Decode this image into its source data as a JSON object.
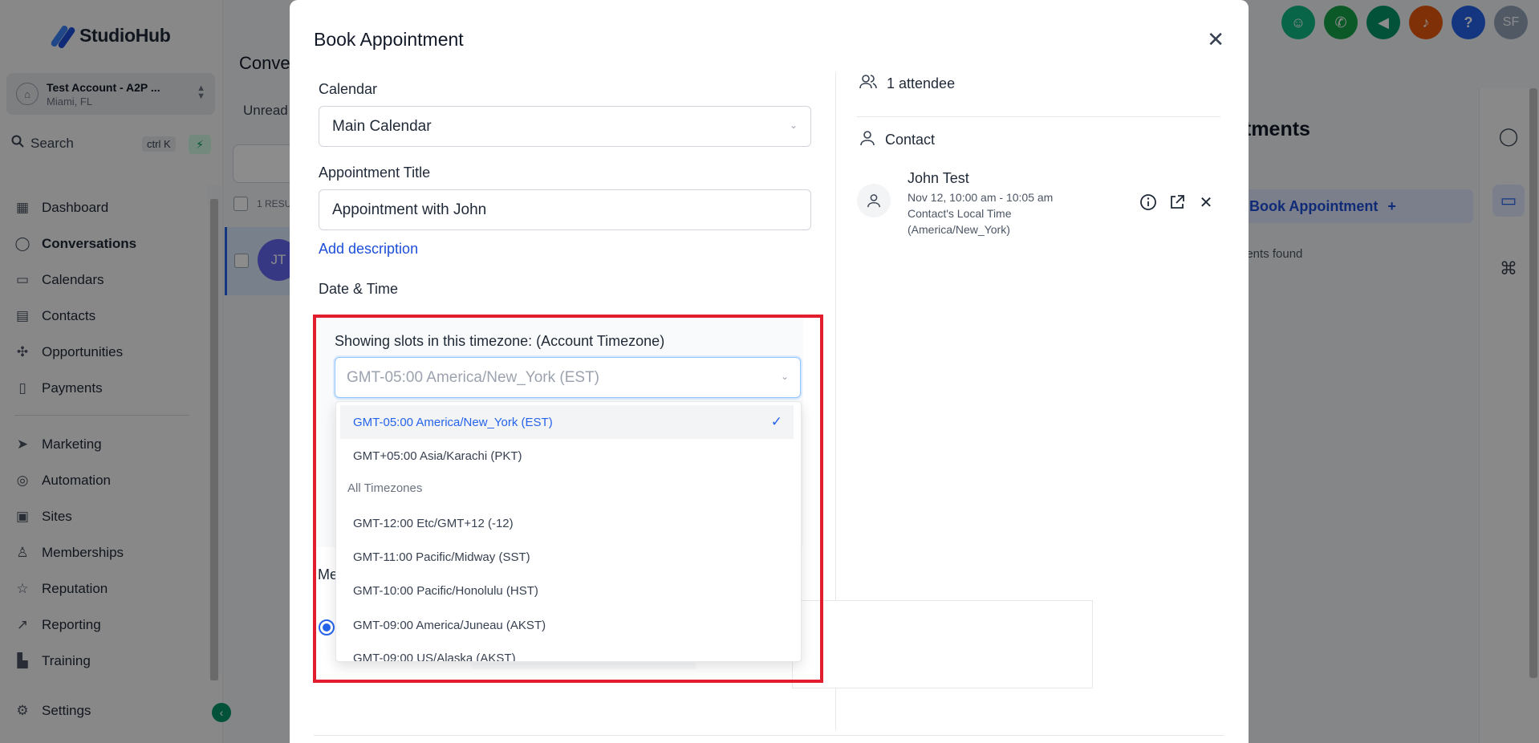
{
  "brand": {
    "name": "StudioHub"
  },
  "account": {
    "name": "Test Account - A2P ...",
    "location": "Miami, FL"
  },
  "search": {
    "label": "Search",
    "shortcut": "ctrl K"
  },
  "sidebar": {
    "items": [
      {
        "label": "Dashboard",
        "icon": "grid-icon"
      },
      {
        "label": "Conversations",
        "icon": "chat-icon"
      },
      {
        "label": "Calendars",
        "icon": "calendar-icon"
      },
      {
        "label": "Contacts",
        "icon": "contacts-icon"
      },
      {
        "label": "Opportunities",
        "icon": "opportunities-icon"
      },
      {
        "label": "Payments",
        "icon": "payments-icon"
      },
      {
        "label": "Marketing",
        "icon": "send-icon"
      },
      {
        "label": "Automation",
        "icon": "automation-icon"
      },
      {
        "label": "Sites",
        "icon": "sites-icon"
      },
      {
        "label": "Memberships",
        "icon": "memberships-icon"
      },
      {
        "label": "Reputation",
        "icon": "star-icon"
      },
      {
        "label": "Reporting",
        "icon": "chart-icon"
      },
      {
        "label": "Training",
        "icon": "book-icon"
      }
    ],
    "settings": "Settings"
  },
  "background": {
    "page_title": "Conve",
    "tab_unread": "Unread",
    "results": "1 RESU",
    "avatar_initials": "JT",
    "appointments_title": "tments",
    "book_button": "Book Appointment",
    "empty": "nents found"
  },
  "topbar": {
    "help": "?",
    "user_initials": "SF"
  },
  "modal": {
    "title": "Book Appointment",
    "calendar_label": "Calendar",
    "calendar_value": "Main Calendar",
    "title_label": "Appointment Title",
    "title_value": "Appointment with John",
    "add_description": "Add description",
    "datetime_label": "Date & Time",
    "tz_label": "Showing slots in this timezone: (Account Timezone)",
    "tz_value": "GMT-05:00 America/New_York (EST)",
    "hidden_label": "Me",
    "attendees": "1 attendee",
    "contact_label": "Contact",
    "contact": {
      "name": "John Test",
      "time": "Nov 12, 10:00 am - 10:05 am",
      "local_line1": "Contact's Local Time",
      "local_line2": "(America/New_York)"
    }
  },
  "dropdown": {
    "options_top": [
      "GMT-05:00 America/New_York (EST)",
      "GMT+05:00 Asia/Karachi (PKT)"
    ],
    "group": "All Timezones",
    "options_all": [
      "GMT-12:00 Etc/GMT+12 (-12)",
      "GMT-11:00 Pacific/Midway (SST)",
      "GMT-10:00 Pacific/Honolulu (HST)",
      "GMT-09:00 America/Juneau (AKST)",
      "GMT-09:00 US/Alaska (AKST)"
    ]
  },
  "colors": {
    "accent": "#2563eb",
    "highlight": "#e11d2e",
    "brand": "#1d4ed8"
  }
}
